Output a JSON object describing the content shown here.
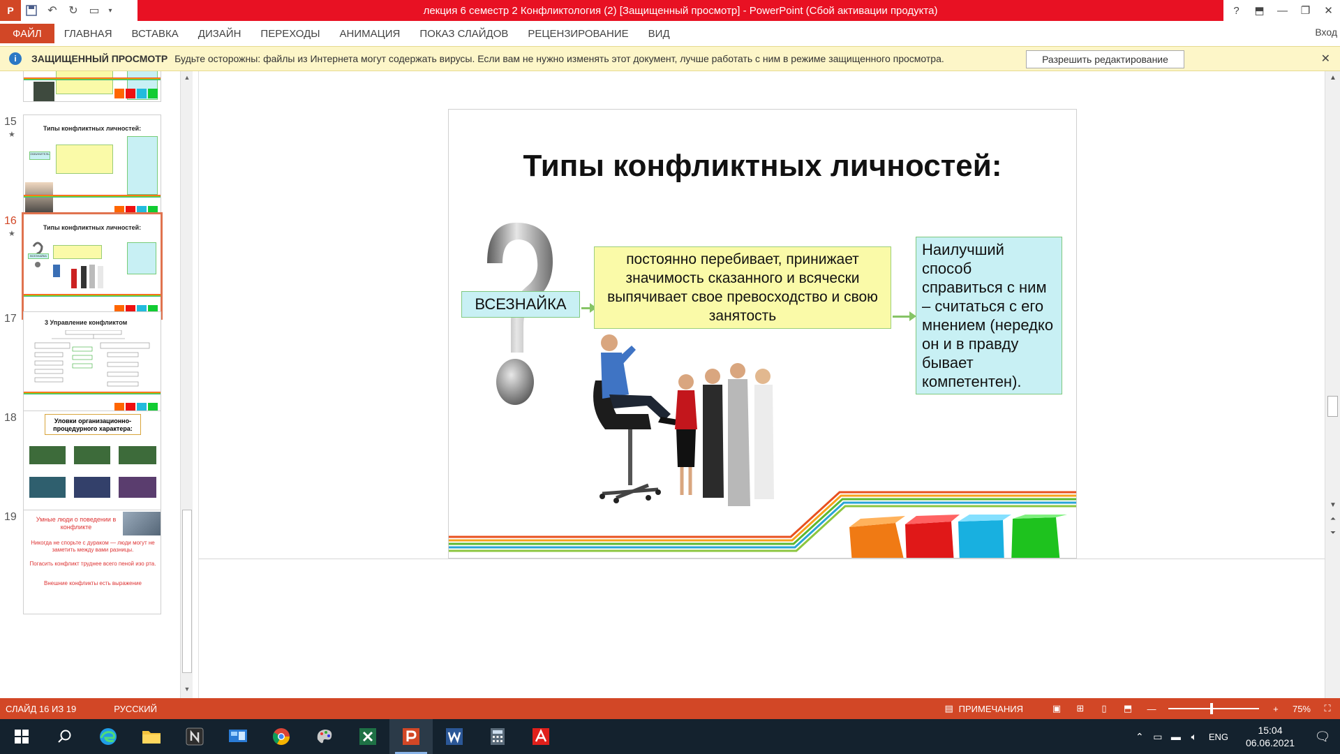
{
  "app": {
    "window_title": "лекция 6 семестр 2 Конфликтология (2) [Защищенный просмотр]  -  PowerPoint (Сбой активации продукта)",
    "app_icon_letter": "P",
    "window_controls": [
      "?",
      "⬒",
      "—",
      "❐",
      "✕"
    ]
  },
  "ribbon": {
    "file_tab": "ФАЙЛ",
    "tabs": [
      "ГЛАВНАЯ",
      "ВСТАВКА",
      "ДИЗАЙН",
      "ПЕРЕХОДЫ",
      "АНИМАЦИЯ",
      "ПОКАЗ СЛАЙДОВ",
      "РЕЦЕНЗИРОВАНИЕ",
      "ВИД"
    ],
    "signin": "Вход"
  },
  "protected_view": {
    "title": "ЗАЩИЩЕННЫЙ ПРОСМОТР",
    "message": "Будьте осторожны: файлы из Интернета могут содержать вирусы. Если вам не нужно изменять этот документ, лучше работать с ним в режиме защищенного просмотра.",
    "enable_button": "Разрешить редактирование"
  },
  "thumbnails": [
    {
      "number": "15",
      "title": "Типы конфликтных личностей:",
      "label": "ОБВИНИТЕЛЬ"
    },
    {
      "number": "16",
      "title": "Типы конфликтных личностей:",
      "label": "ВСЕЗНАЙКА"
    },
    {
      "number": "17",
      "title": "3 Управление конфликтом"
    },
    {
      "number": "18",
      "title": "Уловки организационно-процедурного характера:"
    },
    {
      "number": "19",
      "title": "Умные люди о поведении в конфликте",
      "lines": [
        "Никогда не спорьте с дураком — люди могут не заметить между вами разницы.",
        "Погасить конфликт труднее всего пеной изо рта.",
        "Внешние конфликты есть выражение"
      ]
    }
  ],
  "slide": {
    "title": "Типы конфликтных личностей:",
    "type_label": "ВСЕЗНАЙКА",
    "description": "постоянно перебивает, принижает значимость сказанного и всячески выпячивает свое превосходство и свою занятость",
    "advice": "Наилучший способ справиться с ним – считаться с его мнением (нередко он и в правду бывает компетентен)."
  },
  "status": {
    "slide_indicator": "СЛАЙД 16 ИЗ 19",
    "language": "РУССКИЙ",
    "notes_button": "ПРИМЕЧАНИЯ",
    "zoom": "75%"
  },
  "taskbar": {
    "lang": "ENG",
    "time": "15:04",
    "date": "06.06.2021"
  },
  "colors": {
    "accent": "#d24726",
    "title_red": "#e81123",
    "taskbar": "#14222e"
  }
}
